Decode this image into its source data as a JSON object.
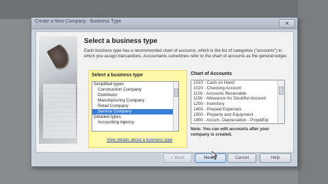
{
  "window": {
    "title": "Create a New Company - Business Type",
    "close_glyph": "✕"
  },
  "main": {
    "heading": "Select a business type",
    "description": "Each business type has a recommended chart of accounts, which is the list of categories (\"accounts\") to which you assign transactions. Accountants sometimes refer to the chart of accounts as the general ledger."
  },
  "business_type": {
    "label": "Select a business type",
    "items": [
      {
        "text": "Simplified types",
        "level": 0,
        "selected": false
      },
      {
        "text": "Construction Company",
        "level": 1,
        "selected": false
      },
      {
        "text": "Distributor",
        "level": 1,
        "selected": false
      },
      {
        "text": "Manufacturing Company",
        "level": 1,
        "selected": false
      },
      {
        "text": "Retail Company",
        "level": 1,
        "selected": false
      },
      {
        "text": "Service Company",
        "level": 1,
        "selected": true
      },
      {
        "text": "Detailed types",
        "level": 0,
        "selected": false
      },
      {
        "text": "Accounting Agency",
        "level": 1,
        "selected": false
      }
    ],
    "link": "View details about a business type"
  },
  "chart_of_accounts": {
    "label": "Chart of Accounts",
    "items": [
      "1010 - Cash on Hand",
      "1020 - Checking Account",
      "1100 - Accounts Receivable",
      "1150 - Allowance for Doubtful Account",
      "1200 - Inventory",
      "1400 - Prepaid Expenses",
      "1500 - Property and Equipment",
      "1900 - Accum. Depreciation - Prop&Eqt"
    ],
    "note": "Note: You can edit accounts after your company is created."
  },
  "buttons": {
    "back": "< Back",
    "next": "Next >",
    "cancel": "Cancel",
    "help": "Help"
  },
  "colors": {
    "selection": "#3a7fd6",
    "highlight_panel": "#fff9a8"
  }
}
